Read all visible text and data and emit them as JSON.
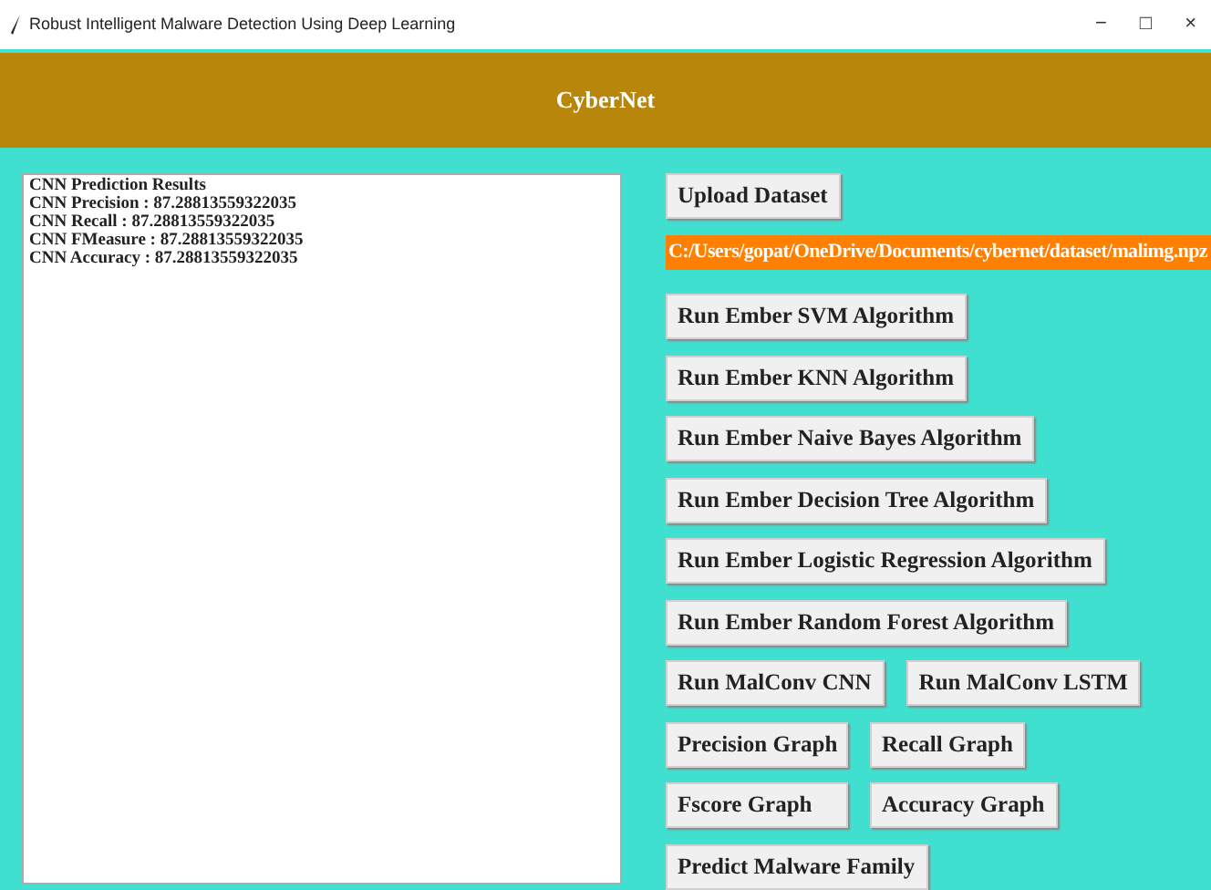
{
  "window": {
    "title": "Robust Intelligent Malware Detection Using Deep Learning",
    "controls": [
      "−",
      "□",
      "×"
    ]
  },
  "header": {
    "title": "CyberNet"
  },
  "results": {
    "lines": [
      "CNN Prediction Results",
      "CNN Precision : 87.28813559322035",
      "CNN Recall : 87.28813559322035",
      "CNN FMeasure : 87.28813559322035",
      "CNN Accuracy : 87.28813559322035"
    ]
  },
  "upload_button": "Upload  Dataset",
  "dataset_path": "C:/Users/gopat/OneDrive/Documents/cybernet/dataset/malimg.npz",
  "button_rows": [
    [
      "Run Ember SVM Algorithm"
    ],
    [
      "Run Ember KNN Algorithm"
    ],
    [
      "Run Ember Naive Bayes Algorithm"
    ],
    [
      "Run Ember Decision Tree Algorithm"
    ],
    [
      "Run Ember Logistic Regression Algorithm"
    ],
    [
      "Run Ember Random Forest Algorithm"
    ],
    [
      "Run MalConv CNN",
      "Run MalConv LSTM"
    ],
    [
      "Precision Graph",
      "Recall Graph"
    ],
    [
      "Fscore Graph",
      "Accuracy Graph"
    ],
    [
      "Predict Malware Family"
    ]
  ]
}
